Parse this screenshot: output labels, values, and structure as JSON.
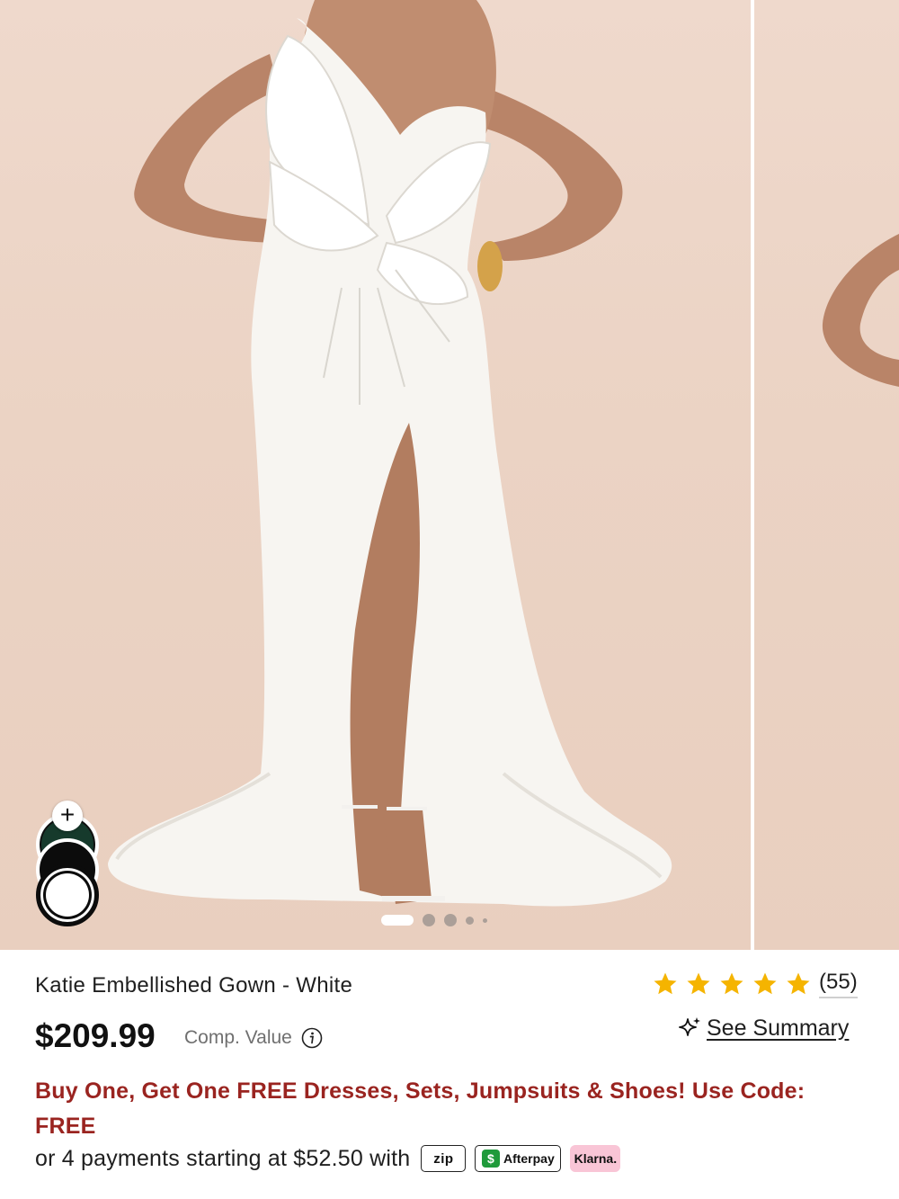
{
  "gallery": {
    "current_index": 1,
    "total_images": 5,
    "swatches": [
      {
        "name": "swatch-green",
        "color": "#163a2c"
      },
      {
        "name": "swatch-black",
        "color": "#0c0c0c"
      },
      {
        "name": "swatch-white",
        "color": "#ffffff",
        "selected": true
      }
    ],
    "add_swatch_symbol": "+"
  },
  "product": {
    "title": "Katie Embellished Gown - White",
    "rating": 5,
    "review_count": "(55)",
    "price": "$209.99",
    "comp_value_label": "Comp. Value",
    "summary_label": "See Summary"
  },
  "promo": {
    "text": "Buy One, Get One FREE Dresses, Sets, Jumpsuits & Shoes! Use Code: FREE",
    "color": "#9a2420"
  },
  "payments": {
    "text": "or 4 payments starting at $52.50 with",
    "providers": {
      "zip": "zip",
      "afterpay": "Afterpay",
      "klarna": "Klarna."
    }
  },
  "colors": {
    "star": "#f5b400",
    "background_tone": "#ebd3c4"
  }
}
